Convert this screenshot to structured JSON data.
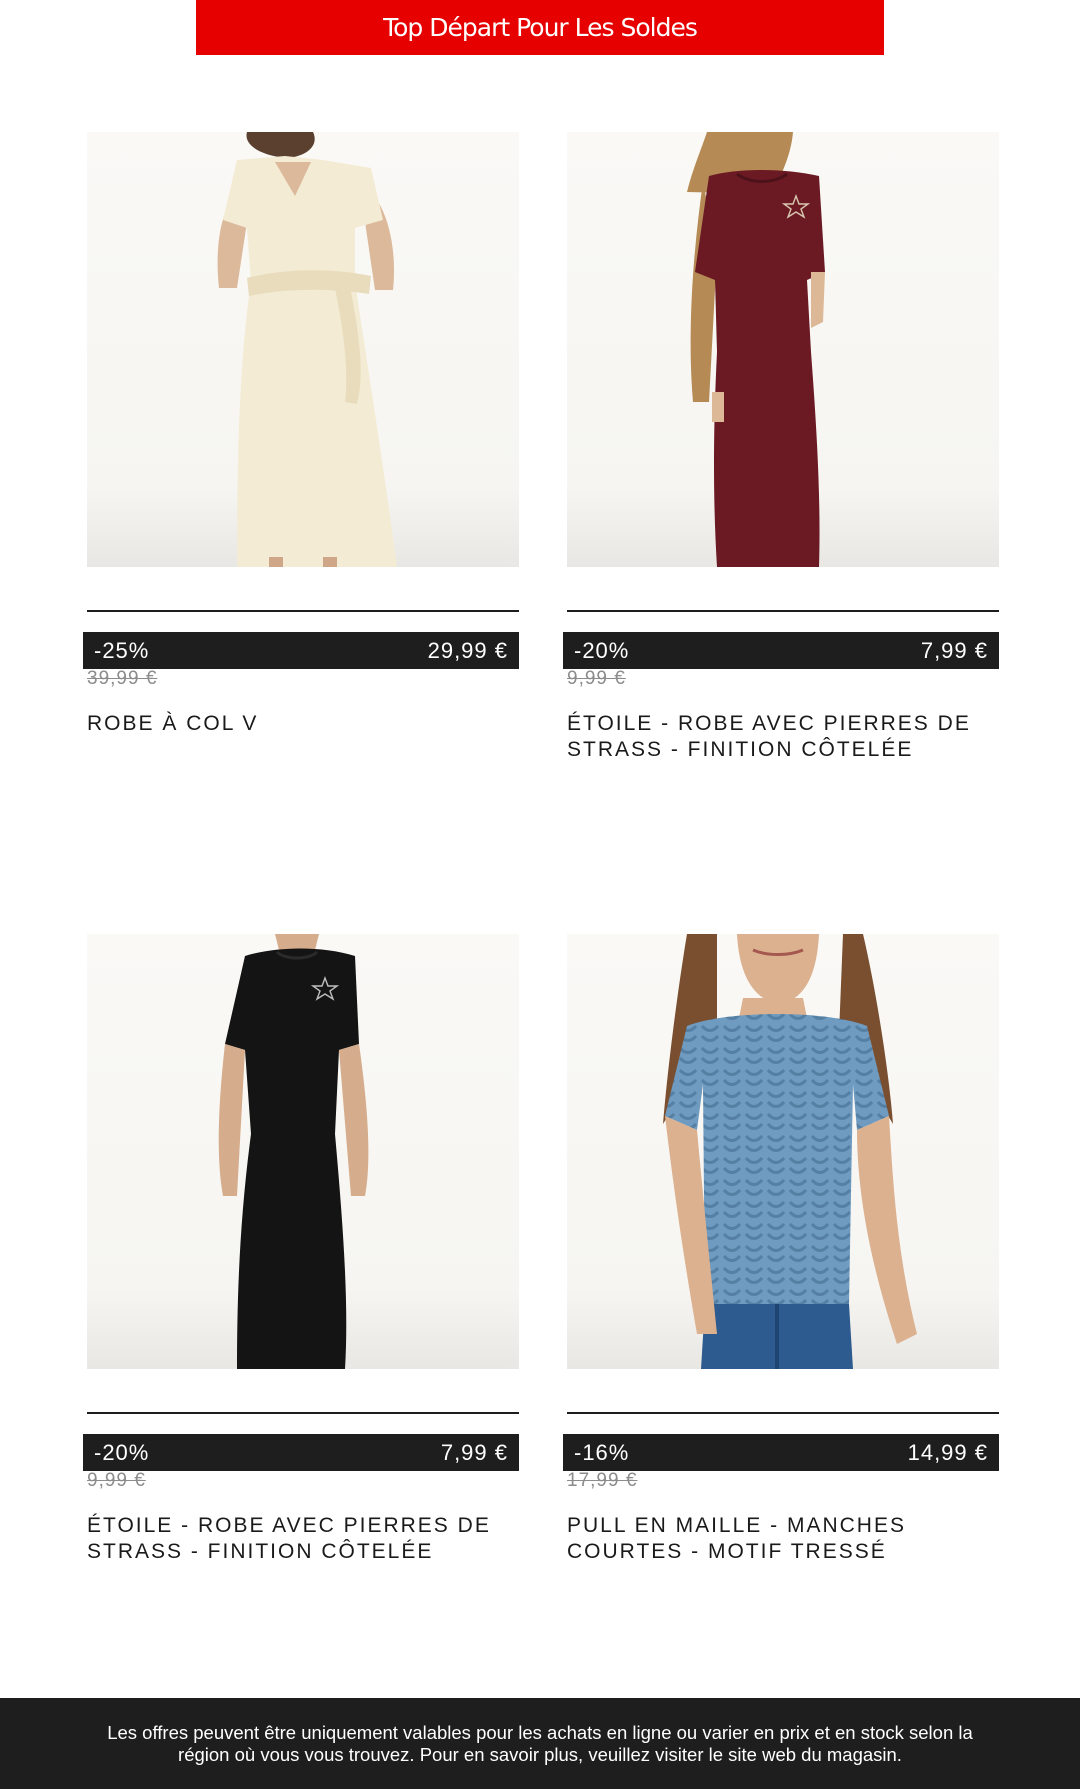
{
  "banner": {
    "label": "Top Départ Pour Les Soldes",
    "color": "#e60000"
  },
  "products": [
    {
      "discount": "-25%",
      "price": "29,99 €",
      "old_price": "39,99 €",
      "title": "ROBE À COL V",
      "image": "woman-cream-v-neck-dress-image"
    },
    {
      "discount": "-20%",
      "price": "7,99 €",
      "old_price": "9,99 €",
      "title": "ÉTOILE - ROBE AVEC PIERRES DE STRASS - FINITION CÔTELÉE",
      "image": "girl-burgundy-star-dress-image"
    },
    {
      "discount": "-20%",
      "price": "7,99 €",
      "old_price": "9,99 €",
      "title": "ÉTOILE - ROBE AVEC PIERRES DE STRASS - FINITION CÔTELÉE",
      "image": "black-star-ribbed-dress-image"
    },
    {
      "discount": "-16%",
      "price": "14,99 €",
      "old_price": "17,99 €",
      "title": "PULL EN MAILLE - MANCHES COURTES - MOTIF TRESSÉ",
      "image": "woman-blue-cable-knit-sweater-image"
    }
  ],
  "footer": {
    "text": "Les offres peuvent être uniquement valables pour les achats en ligne ou varier en prix et en stock selon la région où vous vous trouvez. Pour en savoir plus, veuillez visiter le site web du magasin."
  }
}
